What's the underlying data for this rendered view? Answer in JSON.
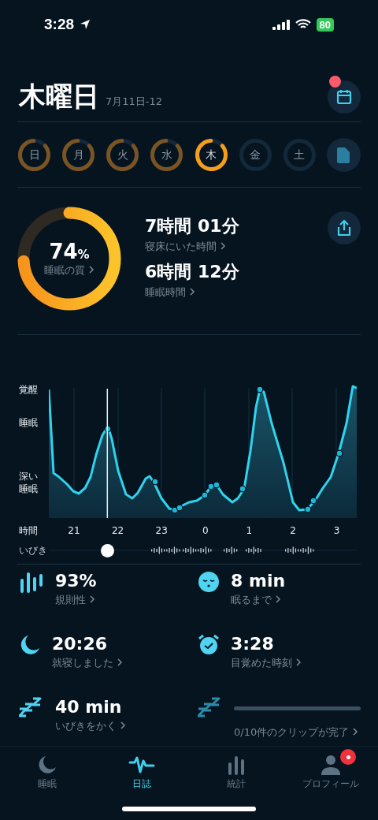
{
  "status_bar": {
    "time": "3:28",
    "battery": "80"
  },
  "header": {
    "title": "木曜日",
    "date": "7月11日-12",
    "calendar_badge": true
  },
  "days": [
    {
      "label": "日",
      "recorded": true,
      "selected": false
    },
    {
      "label": "月",
      "recorded": true,
      "selected": false
    },
    {
      "label": "火",
      "recorded": true,
      "selected": false
    },
    {
      "label": "水",
      "recorded": true,
      "selected": false
    },
    {
      "label": "木",
      "recorded": true,
      "selected": true
    },
    {
      "label": "金",
      "recorded": false,
      "selected": false
    },
    {
      "label": "土",
      "recorded": false,
      "selected": false
    }
  ],
  "summary": {
    "score": "74",
    "unit": "%",
    "score_label": "睡眠の質",
    "metrics": [
      {
        "value": "7時間 01分",
        "label": "寝床にいた時間"
      },
      {
        "value": "6時間 12分",
        "label": "睡眠時間"
      }
    ]
  },
  "graph": {
    "y_labels": [
      "覚醒",
      "睡眠",
      "深い睡眠"
    ],
    "x_title": "時間",
    "x_labels": [
      "21",
      "22",
      "23",
      "0",
      "1",
      "2",
      "3"
    ],
    "snore_label": "いびき"
  },
  "stats": [
    {
      "kind": "regularity",
      "value": "93%",
      "label": "規則性"
    },
    {
      "kind": "asleep",
      "value": "8 min",
      "label": "眠るまで"
    },
    {
      "kind": "bedtime",
      "value": "20:26",
      "label": "就寝しました"
    },
    {
      "kind": "wake",
      "value": "3:28",
      "label": "目覚めた時刻"
    },
    {
      "kind": "snore",
      "value": "40 min",
      "label": "いびきをかく"
    },
    {
      "kind": "clips",
      "level": 0,
      "label": "0/10件のクリップが完了"
    }
  ],
  "tabs": [
    {
      "kind": "moon",
      "label": "睡眠",
      "selected": false,
      "badge": false
    },
    {
      "kind": "wave",
      "label": "日誌",
      "selected": true,
      "badge": false
    },
    {
      "kind": "bars",
      "label": "統計",
      "selected": false,
      "badge": false
    },
    {
      "kind": "person",
      "label": "プロフィール",
      "selected": false,
      "badge": true
    }
  ]
}
